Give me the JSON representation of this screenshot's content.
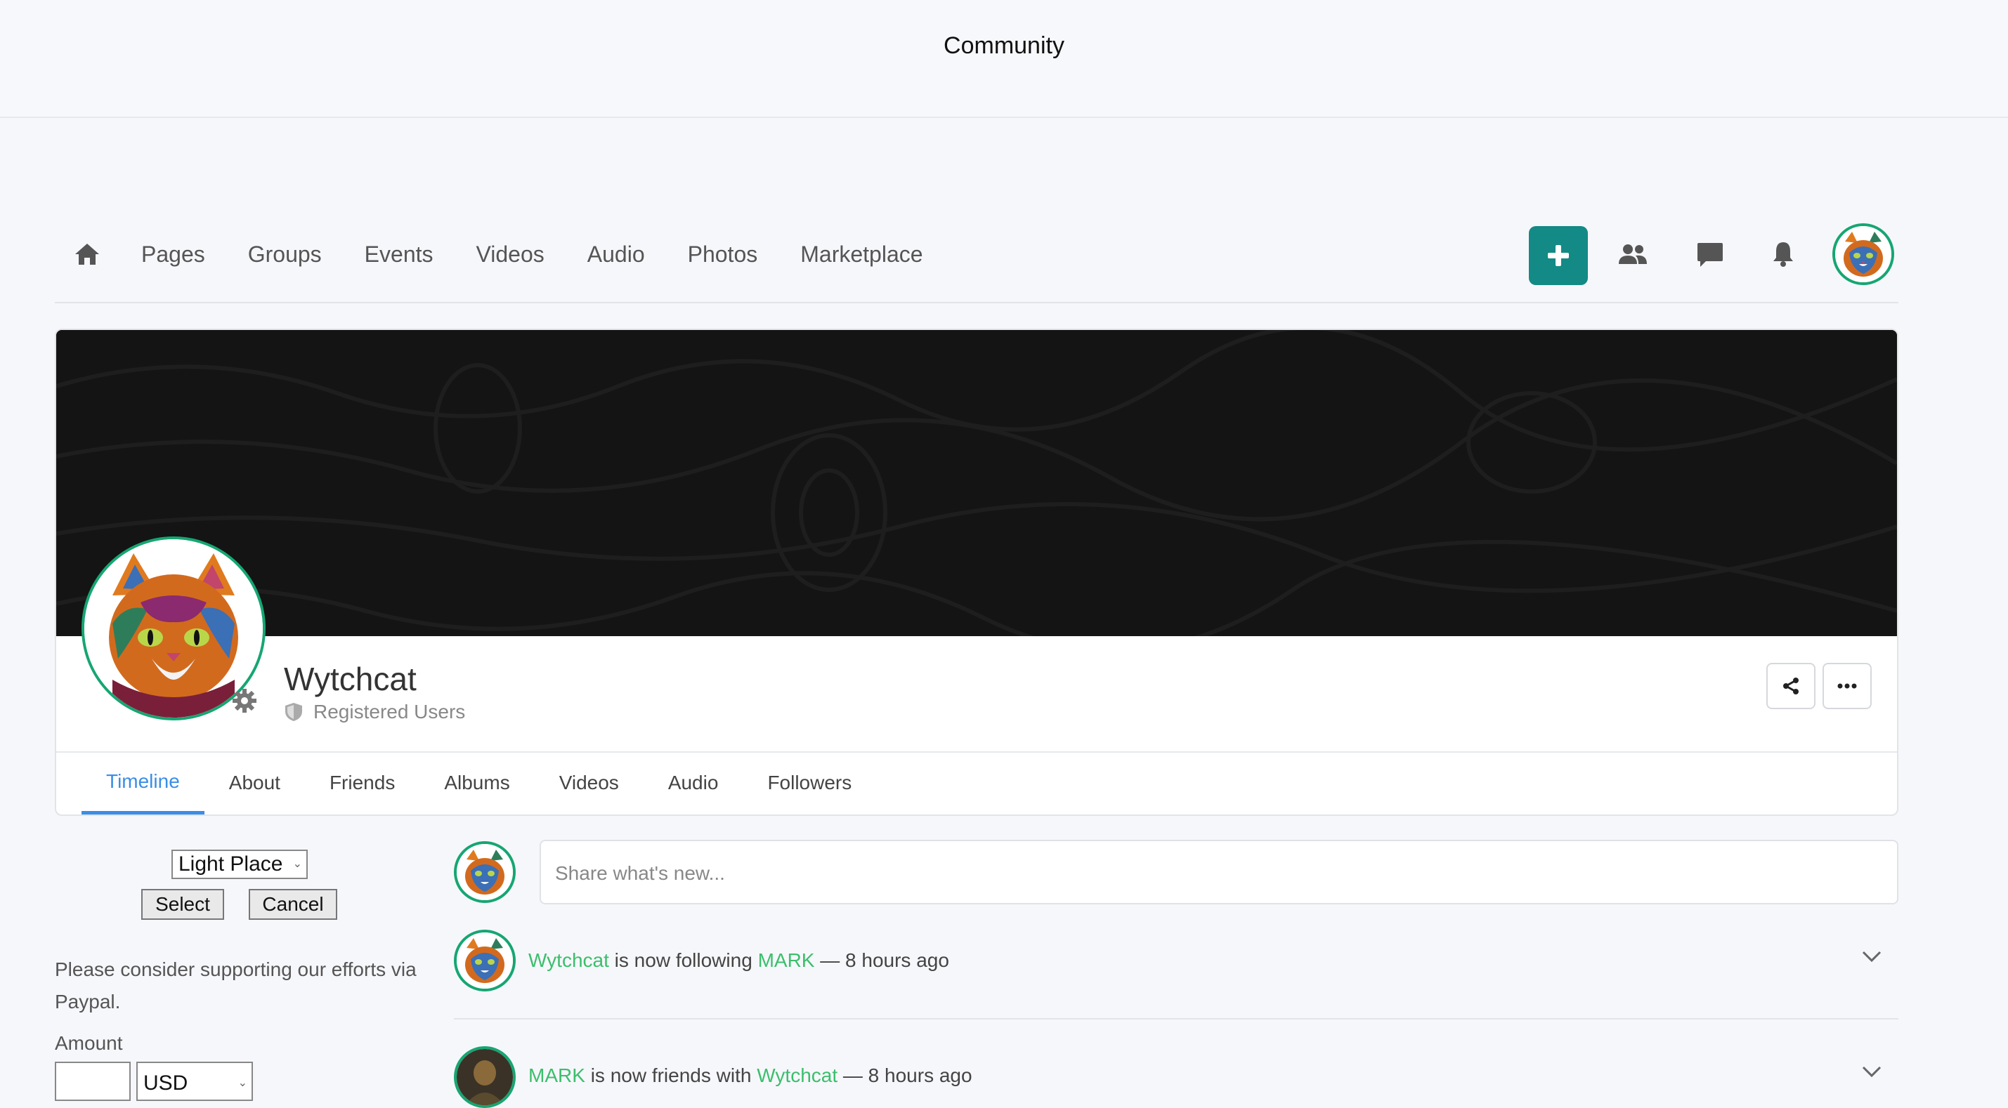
{
  "header": {
    "title": "Community"
  },
  "nav": {
    "links": [
      "Pages",
      "Groups",
      "Events",
      "Videos",
      "Audio",
      "Photos",
      "Marketplace"
    ]
  },
  "profile": {
    "name": "Wytchcat",
    "role": "Registered Users",
    "tabs": [
      "Timeline",
      "About",
      "Friends",
      "Albums",
      "Videos",
      "Audio",
      "Followers"
    ],
    "active_tab": "Timeline"
  },
  "sidebar": {
    "theme_select": "Light Place",
    "select_label": "Select",
    "cancel_label": "Cancel",
    "support_text": "Please consider supporting our efforts via Paypal.",
    "amount_label": "Amount",
    "amount_value": "",
    "currency": "USD"
  },
  "feed": {
    "share_placeholder": "Share what's new...",
    "activities": [
      {
        "actor": "Wytchcat",
        "verb": "is now following",
        "target": "MARK",
        "time": "— 8 hours ago"
      },
      {
        "actor": "MARK",
        "verb": "is now friends with",
        "target": "Wytchcat",
        "time": "— 8 hours ago"
      }
    ]
  },
  "colors": {
    "accent": "#138a85",
    "tab_active": "#3a8ee6",
    "link": "#3bbf6c",
    "avatar_ring": "#16a672"
  }
}
